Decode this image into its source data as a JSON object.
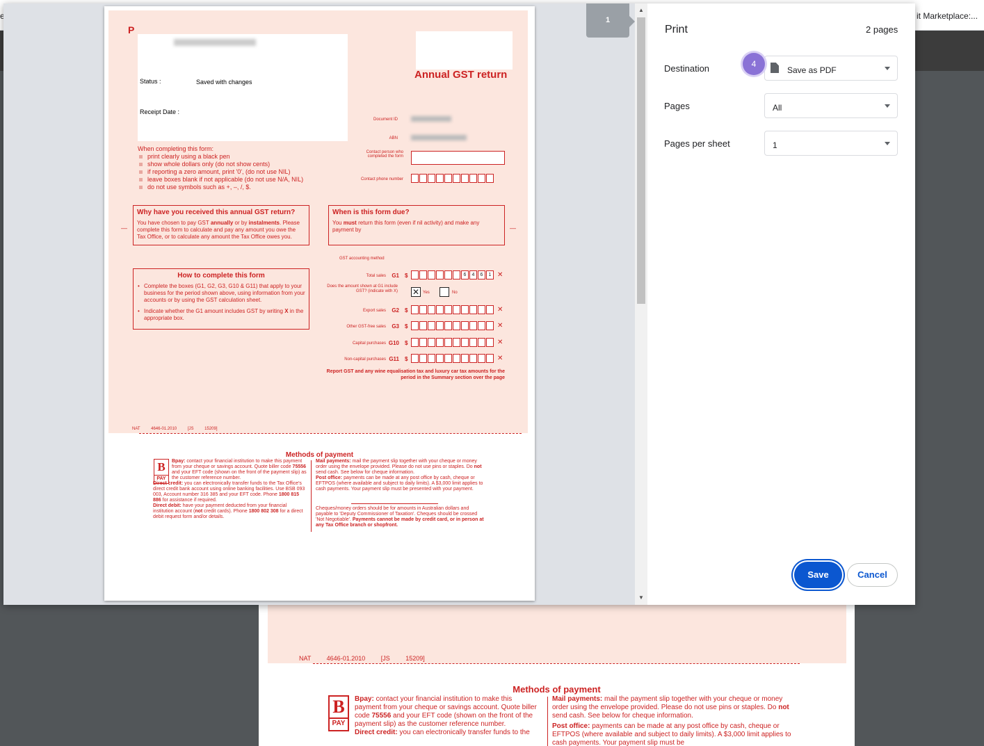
{
  "browser": {
    "tab_left_fragment": "e",
    "tab_right_fragment": "it Marketplace:..."
  },
  "preview": {
    "page_number": "1",
    "form": {
      "letter": "P",
      "status_label": "Status :",
      "status_value": "Saved with changes",
      "receipt_label": "Receipt Date :",
      "title": "Annual GST return",
      "document_id_label": "Document ID",
      "abn_label": "ABN",
      "contact_label": "Contact person who completed the form",
      "phone_label": "Contact phone number",
      "instructions_heading": "When completing this form:",
      "instructions": [
        "print clearly using a black pen",
        "show whole dollars only (do not show cents)",
        "if reporting a zero amount, print '0', (do not use NIL)",
        "leave boxes blank if not applicable (do not use N/A, NIL)",
        "do not use symbols such as +, –, /, $."
      ],
      "why_title": "Why have you received this annual GST return?",
      "why_text_1": "You have chosen to pay GST ",
      "why_bold_1": "annually",
      "why_text_2": " or by ",
      "why_bold_2": "instalments",
      "why_text_3": ". Please complete this form to calculate and pay any amount you owe the Tax Office, or to calculate any amount the Tax Office owes you.",
      "due_title": "When is this form due?",
      "due_text_1": "You ",
      "due_bold": "must",
      "due_text_2": " return this form (even if nil activity) and make any payment by",
      "dash": "—",
      "how_title": "How to complete this form",
      "how_item_1": "Complete the boxes (G1, G2, G3, G10 & G11) that apply to your business for the period shown above, using information from your accounts or by using the GST calculation sheet.",
      "how_item_2a": "Indicate whether the G1 amount includes GST by writing ",
      "how_item_2b": "X",
      "how_item_2c": " in the appropriate box.",
      "accounting_method_label": "GST accounting method",
      "dollar": "$",
      "x_mark": "✕",
      "gst_rows": [
        {
          "label": "Total sales",
          "code": "G1",
          "digits": [
            "",
            "",
            "",
            "",
            "",
            "",
            "6",
            "4",
            "6",
            "1"
          ]
        },
        {
          "label": "Export sales",
          "code": "G2",
          "digits": [
            "",
            "",
            "",
            "",
            "",
            "",
            "",
            "",
            "",
            ""
          ]
        },
        {
          "label": "Other GST-free sales",
          "code": "G3",
          "digits": [
            "",
            "",
            "",
            "",
            "",
            "",
            "",
            "",
            "",
            ""
          ]
        },
        {
          "label": "Capital purchases",
          "code": "G10",
          "digits": [
            "",
            "",
            "",
            "",
            "",
            "",
            "",
            "",
            "",
            ""
          ]
        },
        {
          "label": "Non-capital purchases",
          "code": "G11",
          "digits": [
            "",
            "",
            "",
            "",
            "",
            "",
            "",
            "",
            "",
            ""
          ]
        }
      ],
      "includes_gst_label": "Does the amount shown at G1 include GST? (indicate with X)",
      "yes_mark": "✕",
      "yes_label": "Yes",
      "no_label": "No",
      "report_note": "Report GST and any wine equalisation tax and luxury car tax amounts for the period in the Summary section over the page",
      "footer_code": "NAT 4646-01.2010",
      "footer_js": "[JS 15209]",
      "methods_title": "Methods of payment",
      "bpay_logo_b": "B",
      "bpay_logo_pay": "PAY",
      "bpay_label": "Bpay:",
      "bpay_text_1": " contact your financial institution to make this payment from your cheque or savings account. Quote biller code ",
      "bpay_code": "75556",
      "bpay_text_2": " and your EFT code (shown on the front of the payment slip) as the customer reference number.",
      "direct_credit_label": "Direct credit:",
      "direct_credit_text_1": " you can electronically transfer funds to the Tax Office's direct credit bank account using online banking facilities. Use BSB 093 003, Account number 316 385 and your EFT code. Phone ",
      "direct_credit_phone": "1800 815 886",
      "direct_credit_text_2": " for assistance if required.",
      "direct_debit_label": "Direct debit:",
      "direct_debit_text_1": " have your payment deducted from your financial institution account (",
      "direct_debit_not": "not",
      "direct_debit_text_2": " credit cards). Phone ",
      "direct_debit_phone": "1800 802 308",
      "direct_debit_text_3": " for a direct debit request form and/or details.",
      "mail_label": "Mail payments:",
      "mail_text_1": " mail the payment slip together with your cheque or money order using the envelope provided. Please do not use pins or staples. Do ",
      "mail_not": "not",
      "mail_text_2": " send cash. See below for cheque information.",
      "post_label": "Post office:",
      "post_text": " payments can be made at any post office by cash, cheque or EFTPOS (where available and subject to daily limits). A $3,000 limit applies to cash payments. Your payment slip must be presented with your payment.",
      "cheque_text": "Cheques/money orders should be for amounts in Australian dollars and payable to 'Deputy Commissioner of Taxation'. Cheques should be crossed 'Not Negotiable'. ",
      "cheque_bold": "Payments cannot be made by credit card, or in person at any Tax Office branch or shopfront."
    }
  },
  "background_page": {
    "footer_code": "NAT 4646-01.2010",
    "footer_js": "[JS 15209]",
    "methods_title": "Methods of payment",
    "bpay_logo_b": "B",
    "bpay_logo_pay": "PAY",
    "bpay_label": "Bpay:",
    "bpay_text_1": " contact your financial institution to make this payment from your cheque or savings account. Quote biller code ",
    "bpay_code": "75556",
    "bpay_text_2": " and your EFT code (shown on the front of the payment slip) as the customer reference number.",
    "direct_credit_label": "Direct credit:",
    "direct_credit_text": " you can electronically transfer funds to the",
    "mail_label": "Mail payments:",
    "mail_text_1": " mail the payment slip together with your cheque or money order using the envelope provided. Please do not use pins or staples. Do ",
    "mail_not": "not",
    "mail_text_2": " send cash. See below for cheque information.",
    "post_label": "Post office:",
    "post_text": " payments can be made at any post office by cash, cheque or EFTPOS (where available and subject to daily limits). A $3,000 limit applies to cash payments. Your payment slip must be"
  },
  "print_dialog": {
    "title": "Print",
    "sheet_count": "2 pages",
    "destination_label": "Destination",
    "destination_value": "Save as PDF",
    "destination_icon": "document-icon",
    "step_badge": "4",
    "pages_label": "Pages",
    "pages_value": "All",
    "pages_per_sheet_label": "Pages per sheet",
    "pages_per_sheet_value": "1",
    "save_label": "Save",
    "cancel_label": "Cancel",
    "accent_color": "#0b57d0",
    "badge_color": "#8a72d6"
  }
}
